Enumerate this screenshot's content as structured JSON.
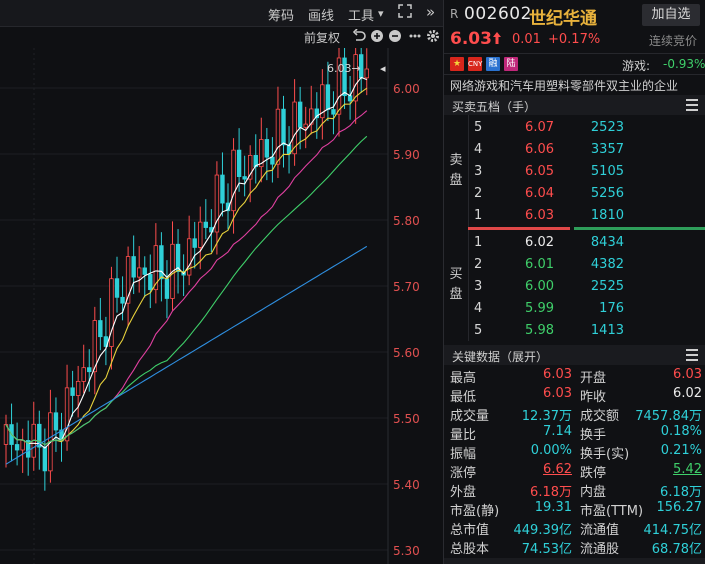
{
  "chart": {
    "toolbar": {
      "chips": "筹码",
      "drawline": "画线",
      "tools": "工具",
      "tools_arrow": "▾",
      "collapse": "»"
    },
    "subbar": {
      "adjust": "前复权"
    },
    "price_axis": [
      "6.00",
      "5.90",
      "5.80",
      "5.70",
      "5.60",
      "5.50",
      "5.40",
      "5.30"
    ],
    "last_marker": "6.03→"
  },
  "stock": {
    "prefix": "R",
    "code": "002602",
    "name": "世纪华通",
    "add_button": "加自选",
    "price": "6.03",
    "change": "0.01",
    "change_pct": "+0.17%",
    "auction_label": "连续竞价",
    "tags": [
      "CNY",
      "融",
      "陆"
    ],
    "sector_label": "游戏:",
    "sector_value": "-0.93%",
    "description": "网络游戏和汽车用塑料零部件双主业的企业"
  },
  "orderbook": {
    "title": "买卖五档（手）",
    "sell_label": [
      "卖",
      "盘"
    ],
    "buy_label": [
      "买",
      "盘"
    ],
    "asks": [
      {
        "level": "5",
        "price": "6.07",
        "vol": "2523"
      },
      {
        "level": "4",
        "price": "6.06",
        "vol": "3357"
      },
      {
        "level": "3",
        "price": "6.05",
        "vol": "5105"
      },
      {
        "level": "2",
        "price": "6.04",
        "vol": "5256"
      },
      {
        "level": "1",
        "price": "6.03",
        "vol": "1810"
      }
    ],
    "bids": [
      {
        "level": "1",
        "price": "6.02",
        "vol": "8434"
      },
      {
        "level": "2",
        "price": "6.01",
        "vol": "4382"
      },
      {
        "level": "3",
        "price": "6.00",
        "vol": "2525"
      },
      {
        "level": "4",
        "price": "5.99",
        "vol": "176"
      },
      {
        "level": "5",
        "price": "5.98",
        "vol": "1413"
      }
    ]
  },
  "keydata": {
    "title": "关键数据（展开）",
    "rows": [
      {
        "l1": "最高",
        "v1": "6.03",
        "l2": "开盘",
        "v2": "6.03"
      },
      {
        "l1": "最低",
        "v1": "6.03",
        "l2": "昨收",
        "v2": "6.02"
      },
      {
        "l1": "成交量",
        "v1": "12.37万",
        "l2": "成交额",
        "v2": "7457.84万"
      },
      {
        "l1": "量比",
        "v1": "7.14",
        "l2": "换手",
        "v2": "0.18%"
      },
      {
        "l1": "振幅",
        "v1": "0.00%",
        "l2": "换手(实)",
        "v2": "0.21%"
      },
      {
        "l1": "涨停",
        "v1": "6.62",
        "l2": "跌停",
        "v2": "5.42"
      },
      {
        "l1": "外盘",
        "v1": "6.18万",
        "l2": "内盘",
        "v2": "6.18万"
      },
      {
        "l1": "市盈(静)",
        "v1": "19.31",
        "l2": "市盈(TTM)",
        "v2": "156.27"
      },
      {
        "l1": "总市值",
        "v1": "449.39亿",
        "l2": "流通值",
        "v2": "414.75亿"
      },
      {
        "l1": "总股本",
        "v1": "74.53亿",
        "l2": "流通股",
        "v2": "68.78亿"
      }
    ]
  },
  "colors": {
    "up": "#ff4d4d",
    "down": "#2fd0d8",
    "ma5": "#ffffff",
    "ma10": "#e8d23c",
    "ma20": "#e040a0",
    "ma30": "#3fcf6a",
    "ma60": "#2f8fe0"
  }
}
